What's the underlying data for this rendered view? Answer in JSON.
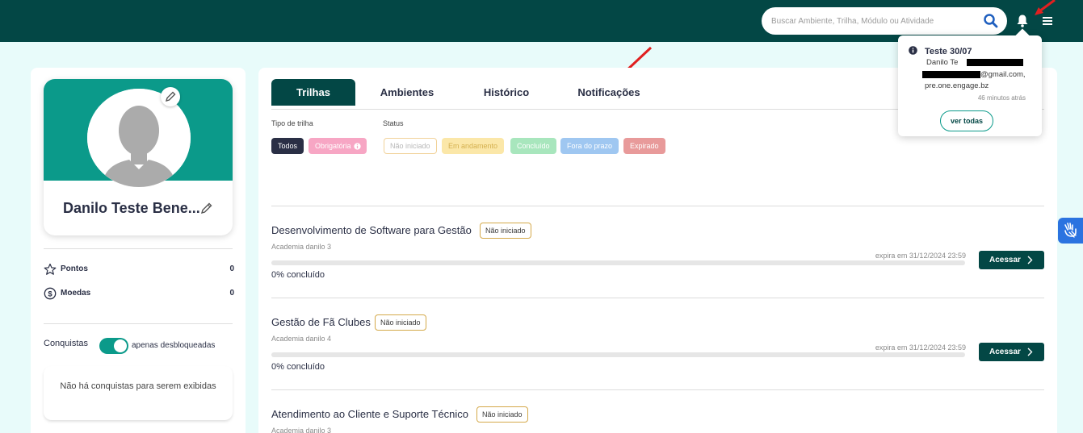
{
  "header": {
    "search_placeholder": "Buscar Ambiente, Trilha, Módulo ou Atividade",
    "icons": [
      "search-icon",
      "bell-icon",
      "hamburger-menu-icon"
    ],
    "brand_color": "#034745"
  },
  "profile": {
    "name": "Danilo Teste Bene...",
    "stats": [
      {
        "label": "Pontos",
        "value": "0",
        "icon": "star-icon"
      },
      {
        "label": "Moedas",
        "value": "0",
        "icon": "dollar-coin-icon"
      }
    ],
    "achievements": {
      "label": "Conquistas",
      "toggle_label": "apenas desbloqueadas",
      "toggle_on": true,
      "empty_message": "Não há conquistas para serem exibidas"
    }
  },
  "tabs": [
    {
      "label": "Trilhas",
      "active": true
    },
    {
      "label": "Ambientes",
      "active": false
    },
    {
      "label": "Histórico",
      "active": false
    },
    {
      "label": "Notificações",
      "active": false
    }
  ],
  "filters": {
    "type_title": "Tipo de trilha",
    "status_title": "Status",
    "type_chips": [
      {
        "label": "Todos",
        "bg": "#2a2f45",
        "color": "#ffffff"
      },
      {
        "label": "Obrigatória",
        "bg": "#f7a6c4",
        "color": "#ffffff"
      }
    ],
    "status_chips": [
      {
        "label": "Não iniciado",
        "bg": "#ffffff",
        "color": "#b8b8b8",
        "border": "#f1d29a"
      },
      {
        "label": "Em andamento",
        "bg": "#fbe7a8",
        "color": "#d9b95a"
      },
      {
        "label": "Concluído",
        "bg": "#a8e6bd",
        "color": "#ffffff"
      },
      {
        "label": "Fora do prazo",
        "bg": "#9fc7f1",
        "color": "#ffffff"
      },
      {
        "label": "Expirado",
        "bg": "#e89a9a",
        "color": "#ffffff"
      }
    ]
  },
  "courses": [
    {
      "title": "Desenvolvimento de Software para Gestão",
      "status": "Não iniciado",
      "academy": "Academia danilo 3",
      "expires": "expira em 31/12/2024 23:59",
      "progress": 0,
      "progress_label": "0% concluído",
      "action": "Acessar"
    },
    {
      "title": "Gestão de Fã Clubes",
      "status": "Não iniciado",
      "academy": "Academia danilo 4",
      "expires": "expira em 31/12/2024 23:59",
      "progress": 0,
      "progress_label": "0% concluído",
      "action": "Acessar"
    },
    {
      "title": "Atendimento ao Cliente e Suporte Técnico",
      "status": "Não iniciado",
      "academy": "Academia danilo 3",
      "expires": "",
      "progress": 0,
      "progress_label": "",
      "action": ""
    }
  ],
  "notification": {
    "title": "Teste 30/07",
    "line1": "Danilo Te",
    "line2": "@gmail.com,",
    "line3": "pre.one.engage.bz",
    "time": "46 minutos atrás",
    "button": "ver todas"
  }
}
